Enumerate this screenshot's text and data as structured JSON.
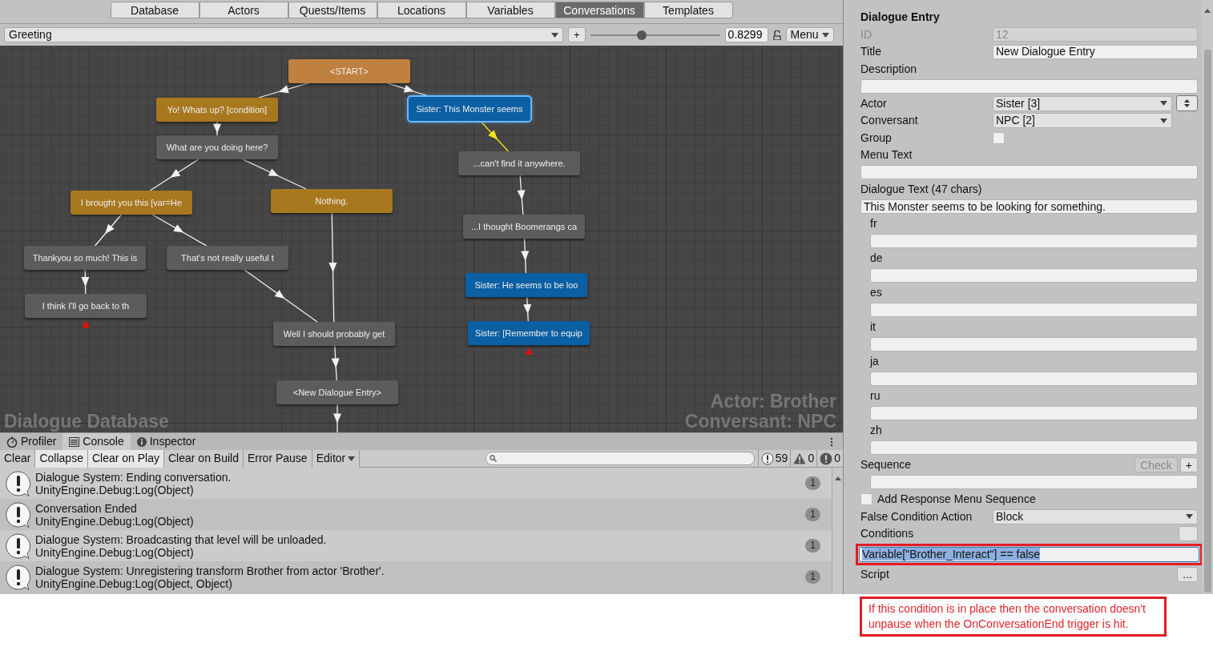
{
  "top_tabs": [
    {
      "label": "Database",
      "selected": false
    },
    {
      "label": "Actors",
      "selected": false
    },
    {
      "label": "Quests/Items",
      "selected": false
    },
    {
      "label": "Locations",
      "selected": false
    },
    {
      "label": "Variables",
      "selected": false
    },
    {
      "label": "Conversations",
      "selected": true
    },
    {
      "label": "Templates",
      "selected": false
    }
  ],
  "toolbar": {
    "conversation": "Greeting",
    "add_button": "+",
    "zoom_slider": {
      "level": 0.4
    },
    "zoom_value": "0.8299",
    "menu": "Menu"
  },
  "canvas": {
    "database_label": "Dialogue Database",
    "actor_label": "Actor: Brother",
    "conversant_label": "Conversant: NPC",
    "nodes": [
      {
        "text": "<START>",
        "kind": "start",
        "selected": false
      },
      {
        "text": "Yo! Whats up? [condition]",
        "kind": "response",
        "selected": false
      },
      {
        "text": "Sister: This Monster seems",
        "kind": "sister",
        "selected": true
      },
      {
        "text": "What are you doing here?",
        "kind": "npc",
        "selected": false
      },
      {
        "text": "...can't find it anywhere.",
        "kind": "npc",
        "selected": false
      },
      {
        "text": "I brought you this [var=He",
        "kind": "response",
        "selected": false
      },
      {
        "text": "Nothing.",
        "kind": "response",
        "selected": false
      },
      {
        "text": "...I thought Boomerangs ca",
        "kind": "npc",
        "selected": false
      },
      {
        "text": "Thankyou so much! This is",
        "kind": "npc",
        "selected": false
      },
      {
        "text": "That's not really useful t",
        "kind": "npc",
        "selected": false
      },
      {
        "text": "Sister: He seems to be loo",
        "kind": "sister",
        "selected": false
      },
      {
        "text": "I think I'll go back to th",
        "kind": "npc",
        "selected": false,
        "end_marker": true
      },
      {
        "text": "Well I should probably get",
        "kind": "npc",
        "selected": false
      },
      {
        "text": "Sister: [Remember to equip",
        "kind": "sister",
        "selected": false,
        "end_marker": true
      },
      {
        "text": "<New Dialogue Entry>",
        "kind": "npc",
        "selected": false,
        "continues": true
      }
    ],
    "links": [
      {
        "highlighted": false
      },
      {
        "highlighted": false
      },
      {
        "highlighted": false
      },
      {
        "highlighted": true
      },
      {
        "highlighted": false
      },
      {
        "highlighted": false
      },
      {
        "highlighted": false
      },
      {
        "highlighted": false
      },
      {
        "highlighted": false
      },
      {
        "highlighted": false
      },
      {
        "highlighted": false
      },
      {
        "highlighted": false
      },
      {
        "highlighted": false
      },
      {
        "highlighted": false
      },
      {
        "highlighted": false
      }
    ]
  },
  "console": {
    "tabs": [
      {
        "label": "Profiler",
        "kind": "profiler",
        "selected": false
      },
      {
        "label": "Console",
        "kind": "console",
        "selected": true
      },
      {
        "label": "Inspector",
        "kind": "inspector",
        "selected": false
      }
    ],
    "toolbar": [
      {
        "label": "Clear",
        "kind": "button",
        "on": false
      },
      {
        "label": "Collapse",
        "kind": "toggle",
        "on": true
      },
      {
        "label": "Clear on Play",
        "kind": "toggle",
        "on": true
      },
      {
        "label": "Clear on Build",
        "kind": "toggle",
        "on": false
      },
      {
        "label": "Error Pause",
        "kind": "toggle",
        "on": false
      },
      {
        "label": "Editor",
        "kind": "dropdown",
        "on": false
      }
    ],
    "counts": {
      "info": "59",
      "warnings": "0",
      "errors": "0"
    },
    "entries": [
      {
        "message": "Dialogue System: Ending conversation.",
        "trace": "UnityEngine.Debug:Log(Object)",
        "count": "1"
      },
      {
        "message": "Conversation Ended",
        "trace": "UnityEngine.Debug:Log(Object)",
        "count": "1"
      },
      {
        "message": "Dialogue System: Broadcasting that level will be unloaded.",
        "trace": "UnityEngine.Debug:Log(Object)",
        "count": "1"
      },
      {
        "message": "Dialogue System: Unregistering transform Brother from actor 'Brother'.",
        "trace": "UnityEngine.Debug:Log(Object, Object)",
        "count": "1"
      }
    ]
  },
  "inspector": {
    "heading": "Dialogue Entry",
    "fields": [
      {
        "kind": "inline",
        "label": "ID",
        "value": "12",
        "disabled": true
      },
      {
        "kind": "inline",
        "label": "Title",
        "value": "New Dialogue Entry",
        "disabled": false
      },
      {
        "kind": "stacked",
        "label": "Description"
      },
      {
        "kind": "dropdown",
        "label": "Actor",
        "value": "Sister [3]",
        "stepper": true
      },
      {
        "kind": "dropdown",
        "label": "Conversant",
        "value": "NPC [2]"
      },
      {
        "kind": "checkbox",
        "label": "Group",
        "checked": false
      },
      {
        "kind": "stacked",
        "label": "Menu Text"
      },
      {
        "kind": "stacked",
        "label": "Dialogue Text (47 chars)",
        "value": "This Monster seems to be looking for something."
      },
      {
        "kind": "language",
        "label": "fr"
      },
      {
        "kind": "language",
        "label": "de"
      },
      {
        "kind": "language",
        "label": "es"
      },
      {
        "kind": "language",
        "label": "it"
      },
      {
        "kind": "language",
        "label": "ja"
      },
      {
        "kind": "language",
        "label": "ru"
      },
      {
        "kind": "language",
        "label": "zh"
      },
      {
        "kind": "sequence",
        "label": "Sequence",
        "buttons": [
          {
            "label": "Check",
            "disabled": true
          },
          {
            "label": "+",
            "disabled": false
          }
        ]
      },
      {
        "kind": "checkbox-left",
        "label": "Add Response Menu Sequence",
        "checked": false
      },
      {
        "kind": "dropdown-wide",
        "label": "False Condition Action",
        "value": "Block"
      },
      {
        "kind": "stacked",
        "label": "Conditions",
        "value": "Variable[\"Brother_Interact\"] == false",
        "text_selected": true,
        "annotated": true,
        "menu_button": true
      },
      {
        "kind": "label-only",
        "label": "Script",
        "buttons": [
          {
            "label": "...",
            "disabled": false
          }
        ]
      }
    ]
  },
  "annotation": {
    "text": "If this condition is in place then the conversation doesn't unpause when the OnConversationEnd trigger is hit."
  }
}
